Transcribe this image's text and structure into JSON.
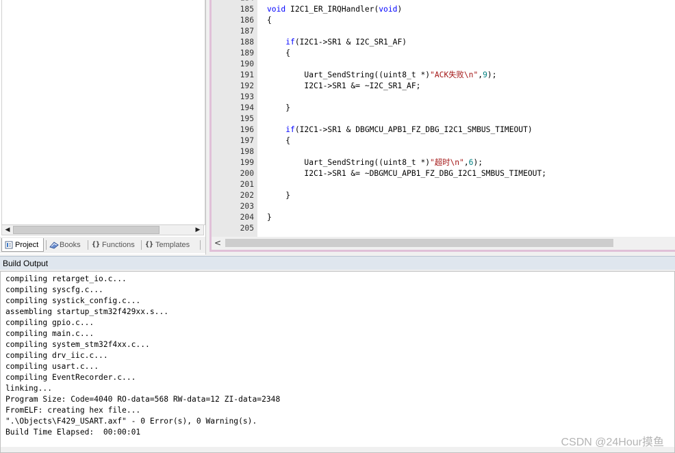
{
  "left_panel": {
    "tabs": [
      {
        "label": "Project",
        "icon": "project-icon",
        "active": true
      },
      {
        "label": "Books",
        "icon": "books-icon",
        "active": false
      },
      {
        "label": "Functions",
        "icon": "functions-icon",
        "active": false
      },
      {
        "label": "Templates",
        "icon": "templates-icon",
        "active": false
      }
    ]
  },
  "editor": {
    "lines": [
      {
        "n": "185",
        "code": "void I2C1_ER_IRQHandler(void)"
      },
      {
        "n": "186",
        "code": "{"
      },
      {
        "n": "187",
        "code": ""
      },
      {
        "n": "188",
        "code": "    if(I2C1->SR1 & I2C_SR1_AF)"
      },
      {
        "n": "189",
        "code": "    {"
      },
      {
        "n": "190",
        "code": ""
      },
      {
        "n": "191",
        "code": "        Uart_SendString((uint8_t *)\"ACK失败\\n\",9);"
      },
      {
        "n": "192",
        "code": "        I2C1->SR1 &= ~I2C_SR1_AF;"
      },
      {
        "n": "193",
        "code": ""
      },
      {
        "n": "194",
        "code": "    }"
      },
      {
        "n": "195",
        "code": ""
      },
      {
        "n": "196",
        "code": "    if(I2C1->SR1 & DBGMCU_APB1_FZ_DBG_I2C1_SMBUS_TIMEOUT)"
      },
      {
        "n": "197",
        "code": "    {"
      },
      {
        "n": "198",
        "code": ""
      },
      {
        "n": "199",
        "code": "        Uart_SendString((uint8_t *)\"超时\\n\",6);"
      },
      {
        "n": "200",
        "code": "        I2C1->SR1 &= ~DBGMCU_APB1_FZ_DBG_I2C1_SMBUS_TIMEOUT;"
      },
      {
        "n": "201",
        "code": ""
      },
      {
        "n": "202",
        "code": "    }"
      },
      {
        "n": "203",
        "code": ""
      },
      {
        "n": "204",
        "code": "}"
      },
      {
        "n": "205",
        "code": ""
      }
    ],
    "fold_markers": [
      "186",
      "189",
      "197"
    ],
    "colors": {
      "keyword": "#0000ff",
      "string": "#a31515",
      "number": "#008080"
    }
  },
  "build_output": {
    "title": "Build Output",
    "lines": [
      "compiling retarget_io.c...",
      "compiling syscfg.c...",
      "compiling systick_config.c...",
      "assembling startup_stm32f429xx.s...",
      "compiling gpio.c...",
      "compiling main.c...",
      "compiling system_stm32f4xx.c...",
      "compiling drv_iic.c...",
      "compiling usart.c...",
      "compiling EventRecorder.c...",
      "linking...",
      "Program Size: Code=4040 RO-data=568 RW-data=12 ZI-data=2348",
      "FromELF: creating hex file...",
      "\".\\Objects\\F429_USART.axf\" - 0 Error(s), 0 Warning(s).",
      "Build Time Elapsed:  00:00:01"
    ]
  },
  "watermark": "CSDN @24Hour摸鱼"
}
